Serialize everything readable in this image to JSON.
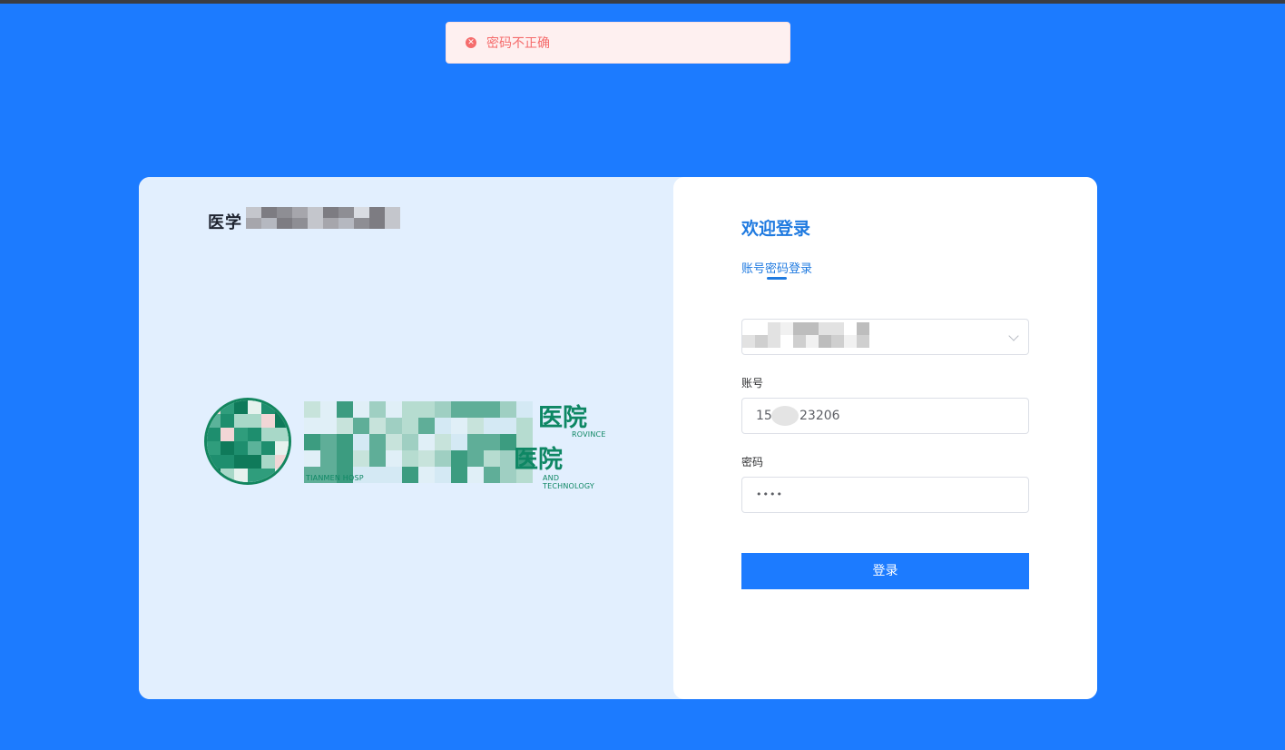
{
  "toast": {
    "icon": "error-circle-icon",
    "message": "密码不正确",
    "color": "#f56c6c"
  },
  "left": {
    "title_visible": "医学",
    "hospital_line1_suffix": "医院",
    "hospital_line2_suffix": "医院",
    "sub1_suffix": "ROVINCE",
    "sub2_prefix": "TIANMEN HOSP",
    "sub2_suffix": "AND TECHNOLOGY"
  },
  "form": {
    "welcome": "欢迎登录",
    "tab_label": "账号密码登录",
    "account_label": "账号",
    "account_value_start": "15",
    "account_value_end": "23206",
    "password_label": "密码",
    "password_value": "••••",
    "submit_label": "登录"
  },
  "colors": {
    "background": "#1c7bff",
    "accent": "#1f7ae0",
    "left_panel": "#e2effe",
    "hospital_green": "#0e8764"
  }
}
